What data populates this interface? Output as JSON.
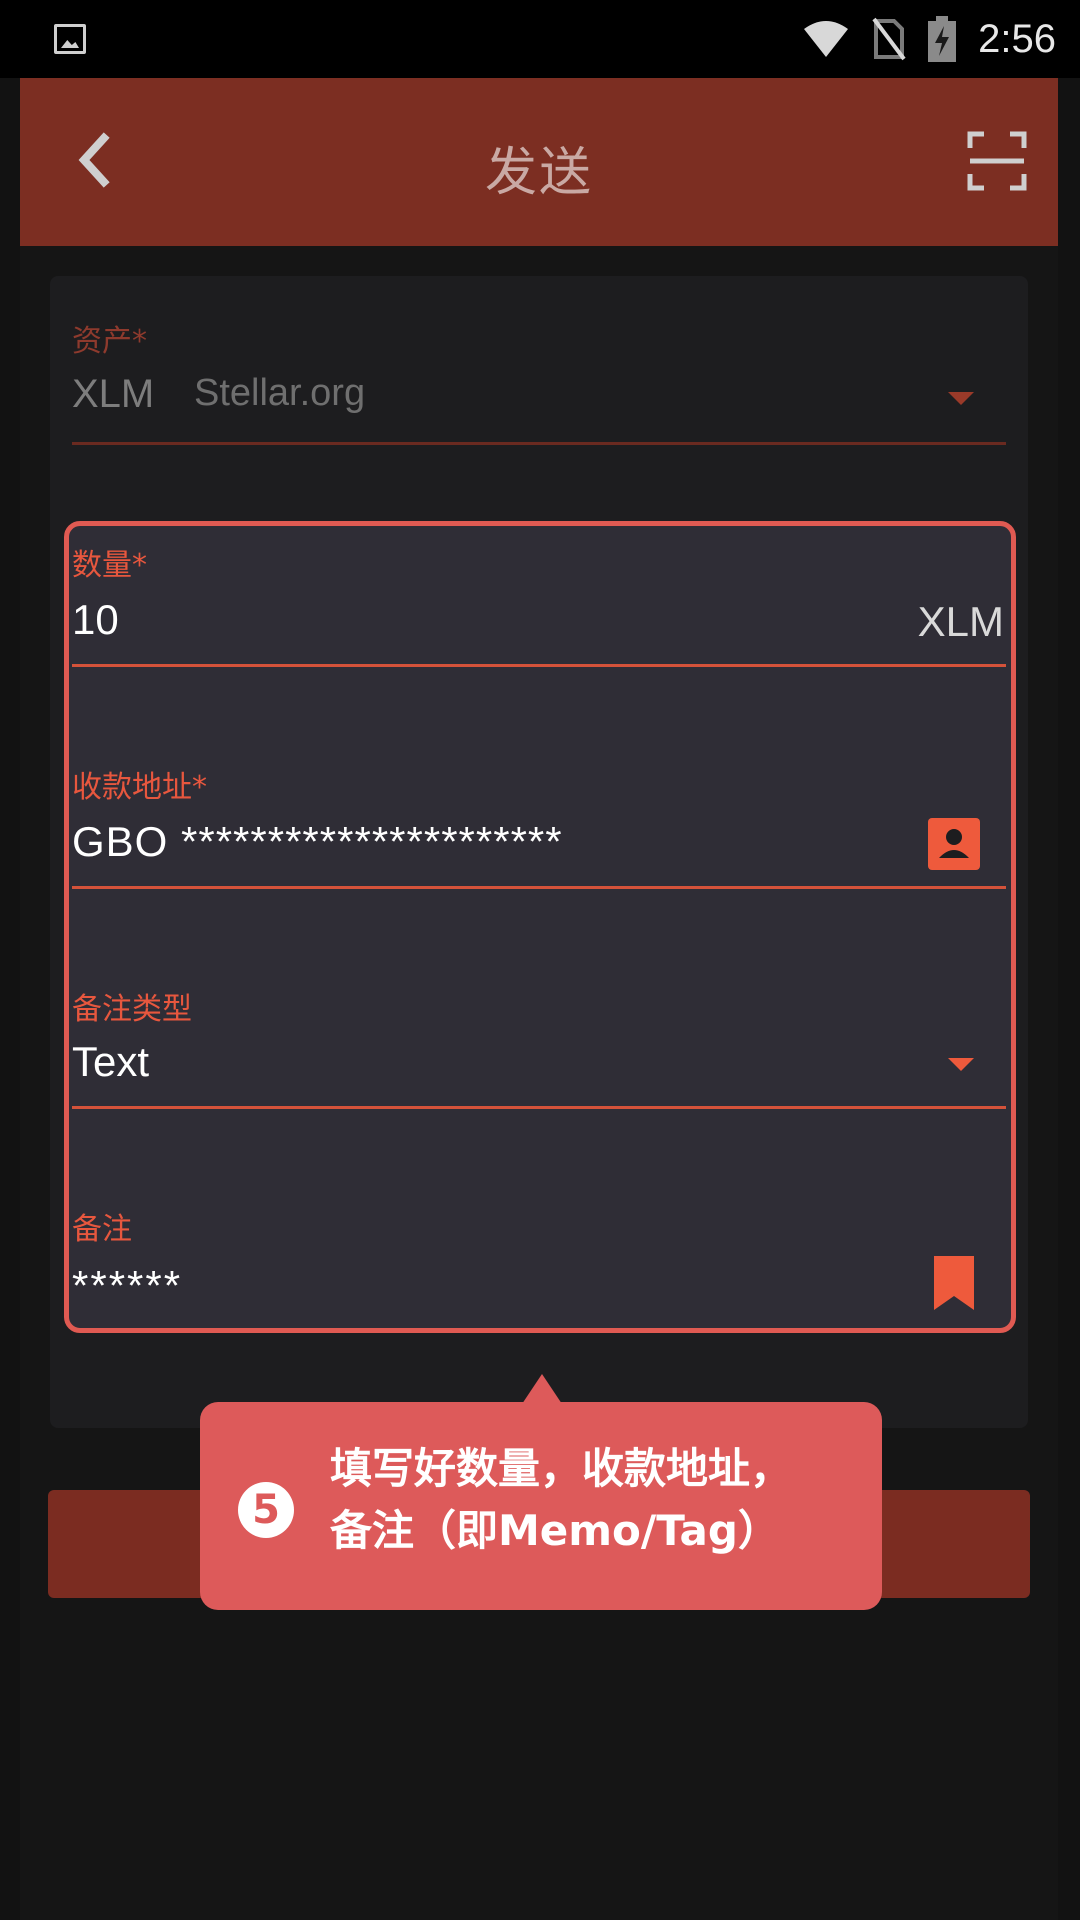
{
  "status_bar": {
    "time": "2:56"
  },
  "app_bar": {
    "title": "发送"
  },
  "asset": {
    "label": "资产*",
    "code": "XLM",
    "issuer": "Stellar.org"
  },
  "amount": {
    "label": "数量*",
    "value": "10",
    "unit": "XLM"
  },
  "recipient": {
    "label": "收款地址*",
    "value": "GBO **********************"
  },
  "memo_type": {
    "label": "备注类型",
    "value": "Text"
  },
  "memo": {
    "label": "备注",
    "value": "******"
  },
  "tooltip": {
    "step": "5",
    "text_line1": "填写好数量，收款地址，",
    "text_line2": "备注（即Memo/Tag）"
  },
  "colors": {
    "app_bar": "#7c2e22",
    "accent": "#e8573e",
    "highlight_border": "#e05a52",
    "tooltip_bg": "#dd5a5a"
  }
}
